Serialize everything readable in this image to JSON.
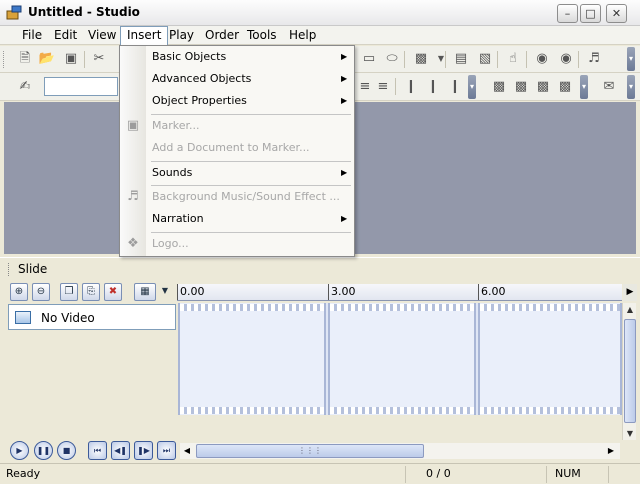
{
  "window": {
    "title": "Untitled - Studio"
  },
  "window_controls": {
    "minimize": "–",
    "maximize": "□",
    "close": "✕"
  },
  "menubar": {
    "items": [
      {
        "label": "File"
      },
      {
        "label": "Edit"
      },
      {
        "label": "View"
      },
      {
        "label": "Insert"
      },
      {
        "label": "Play"
      },
      {
        "label": "Order"
      },
      {
        "label": "Tools"
      },
      {
        "label": "Help"
      }
    ]
  },
  "insert_menu": {
    "items": [
      {
        "label": "Basic Objects",
        "submenu": true,
        "enabled": true
      },
      {
        "label": "Advanced Objects",
        "submenu": true,
        "enabled": true
      },
      {
        "label": "Object Properties",
        "submenu": true,
        "enabled": true
      },
      {
        "label": "Marker...",
        "enabled": false,
        "icon": "marker-icon"
      },
      {
        "label": "Add a Document to Marker...",
        "enabled": false
      },
      {
        "label": "Sounds",
        "submenu": true,
        "enabled": true
      },
      {
        "label": "Background Music/Sound Effect ...",
        "enabled": false,
        "icon": "music-icon"
      },
      {
        "label": "Narration",
        "submenu": true,
        "enabled": true
      },
      {
        "label": "Logo...",
        "enabled": false,
        "icon": "logo-icon"
      }
    ],
    "submenu_arrow": "▶"
  },
  "slide_panel": {
    "label": "Slide"
  },
  "timeline": {
    "ruler_labels": [
      "0.00",
      "3.00",
      "6.00"
    ],
    "tracks": [
      {
        "label": "No Video"
      }
    ]
  },
  "transport": {
    "buttons": [
      {
        "name": "play-button",
        "glyph": "▶"
      },
      {
        "name": "pause-button",
        "glyph": "❚❚"
      },
      {
        "name": "stop-button",
        "glyph": "■"
      },
      {
        "name": "first-button",
        "glyph": "⏮"
      },
      {
        "name": "prev-button",
        "glyph": "◀❚"
      },
      {
        "name": "next-button",
        "glyph": "❚▶"
      },
      {
        "name": "last-button",
        "glyph": "⏭"
      }
    ]
  },
  "statusbar": {
    "status": "Ready",
    "counter": "0 / 0",
    "num": "NUM"
  },
  "colors": {
    "canvas": "#9398aa",
    "menu_highlight": "#7f9db9",
    "disabled_text": "#a7a7a7"
  }
}
